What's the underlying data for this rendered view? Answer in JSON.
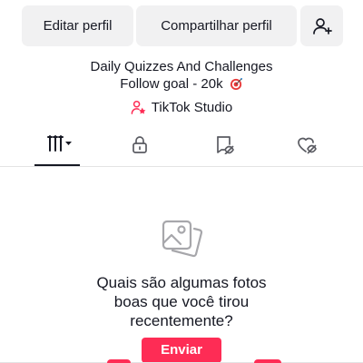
{
  "profile_actions": {
    "edit_label": "Editar perfil",
    "share_label": "Compartilhar perfil",
    "add_friend_icon": "person-plus-icon"
  },
  "bio": {
    "line1": "Daily Quizzes And Challenges",
    "line2": "Follow goal - 20k",
    "line2_emoji": "target-icon"
  },
  "studio": {
    "label": "TikTok Studio",
    "icon": "studio-person-star-icon",
    "icon_color": "#fe2c55"
  },
  "tabs": [
    {
      "name": "grid",
      "icon": "grid-lines-dropdown-icon",
      "active": true
    },
    {
      "name": "private",
      "icon": "lock-icon",
      "active": false
    },
    {
      "name": "reposts",
      "icon": "repost-hidden-icon",
      "active": false
    },
    {
      "name": "liked",
      "icon": "heart-hidden-icon",
      "active": false
    }
  ],
  "empty_state": {
    "icon": "photos-icon",
    "line1": "Quais são algumas fotos",
    "line2": "boas que você tirou",
    "line3": "recentemente?",
    "button_label": "Enviar"
  },
  "colors": {
    "accent": "#fe2c55",
    "text": "#161823",
    "button_bg": "#f1f1f2"
  }
}
